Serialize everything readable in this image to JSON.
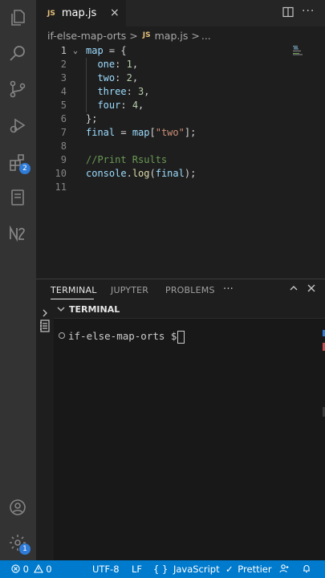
{
  "tab": {
    "badge": "JS",
    "label": "map.js",
    "close": "×"
  },
  "breadcrumb": {
    "folder": "if-else-map-orts",
    "sep1": ">",
    "badge": "JS",
    "file": "map.js",
    "sep2": ">",
    "more": "..."
  },
  "editor": {
    "line_numbers": [
      "1",
      "2",
      "3",
      "4",
      "5",
      "6",
      "7",
      "8",
      "9",
      "10",
      "11"
    ],
    "lines": {
      "l1": {
        "a": "map",
        "b": " = {"
      },
      "l2": {
        "a": "one",
        "b": ": ",
        "c": "1",
        "d": ","
      },
      "l3": {
        "a": "two",
        "b": ": ",
        "c": "2",
        "d": ","
      },
      "l4": {
        "a": "three",
        "b": ": ",
        "c": "3",
        "d": ","
      },
      "l5": {
        "a": "four",
        "b": ": ",
        "c": "4",
        "d": ","
      },
      "l6": {
        "a": "};"
      },
      "l7": {
        "a": "final",
        "b": " = ",
        "c": "map",
        "d": "[",
        "e": "\"two\"",
        "f": "];"
      },
      "l9": {
        "a": "//Print Rsults"
      },
      "l10": {
        "a": "console",
        "b": ".",
        "c": "log",
        "d": "(",
        "e": "final",
        "f": ");"
      }
    }
  },
  "panel": {
    "tabs": [
      "TERMINAL",
      "JUPYTER",
      "PROBLEMS"
    ],
    "more": "···",
    "section_title": "TERMINAL"
  },
  "terminal": {
    "prompt": "if-else-map-orts $"
  },
  "activity": {
    "extensions_badge": "2",
    "accounts_badge": "1",
    "n_label": "N"
  },
  "status": {
    "errors": "0",
    "warnings": "0",
    "encoding": "UTF-8",
    "eol": "LF",
    "language_icon": "{ }",
    "language": "JavaScript",
    "prettier": "Prettier"
  },
  "colors": {
    "accent": "#007acc",
    "badge": "#2f7bd8"
  }
}
